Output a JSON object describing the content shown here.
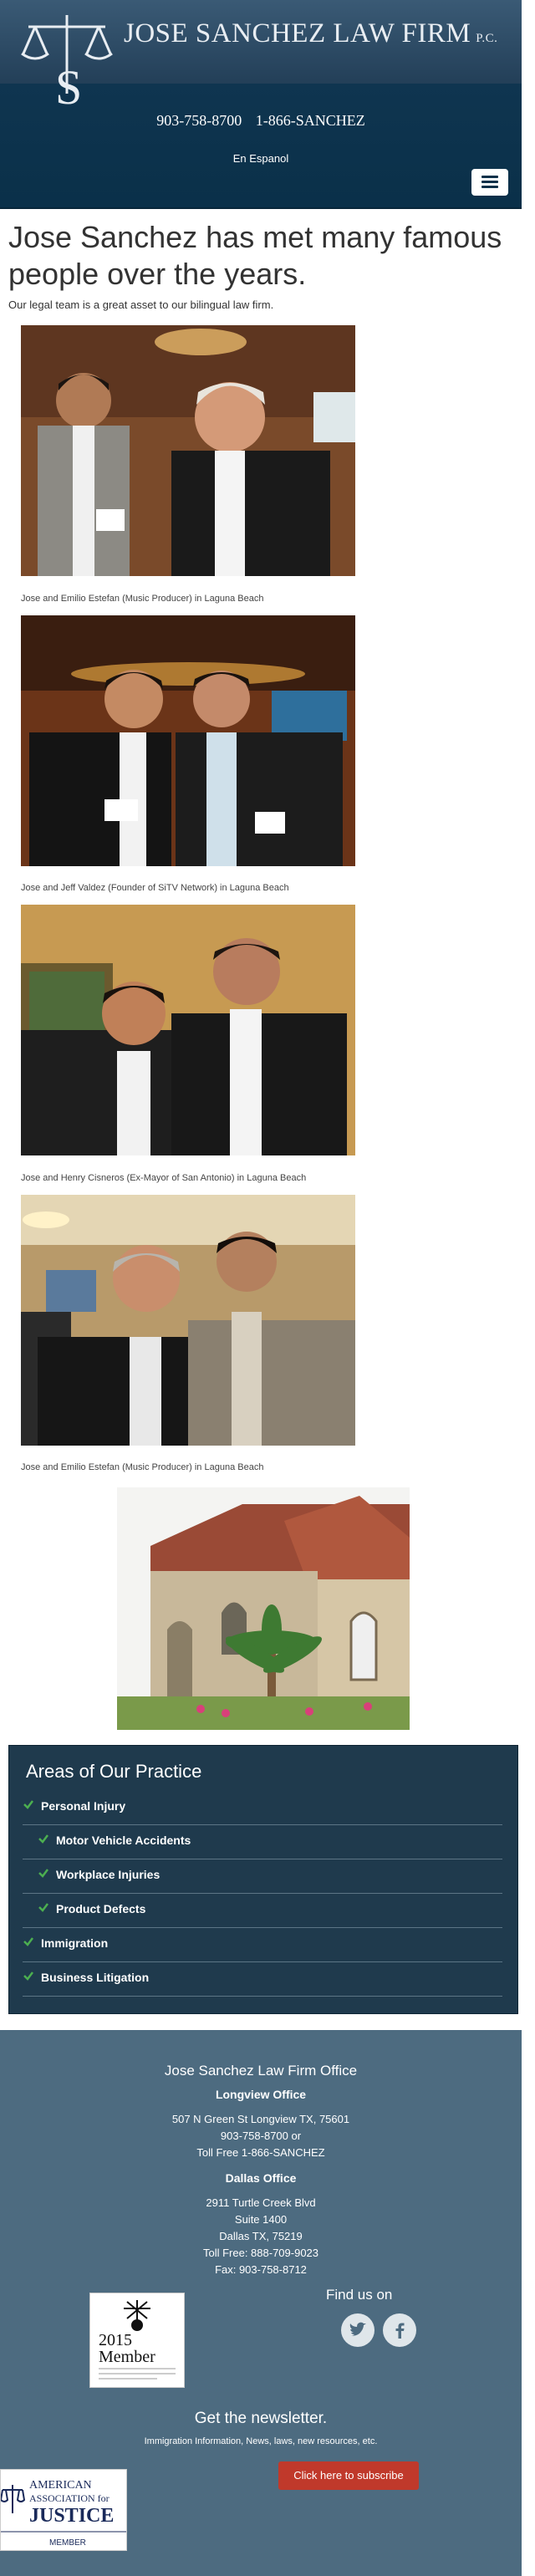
{
  "header": {
    "firm_name": "JOSE SANCHEZ LAW FIRM",
    "firm_suffix": "P.C.",
    "phone_local": "903-758-8700",
    "phone_toll": "1-866-SANCHEZ",
    "language_link": "En Espanol",
    "menu_icon": "hamburger-icon"
  },
  "main": {
    "heading": "Jose Sanchez has met many famous people over the years.",
    "intro": "Our legal team is a great asset to our bilingual law firm.",
    "photos": [
      {
        "caption": "Jose and Emilio Estefan (Music Producer) in Laguna Beach"
      },
      {
        "caption": "Jose and Jeff Valdez (Founder of SiTV Network) in Laguna Beach"
      },
      {
        "caption": "Jose and Henry Cisneros (Ex-Mayor of San Antonio) in Laguna Beach"
      },
      {
        "caption": "Jose and Emilio Estefan (Music Producer) in Laguna Beach"
      }
    ]
  },
  "practice": {
    "title": "Areas of Our Practice",
    "items": [
      {
        "label": "Personal Injury"
      },
      {
        "label": "Motor Vehicle Accidents"
      },
      {
        "label": "Workplace Injuries"
      },
      {
        "label": "Product Defects"
      },
      {
        "label": "Immigration"
      },
      {
        "label": "Business Litigation"
      }
    ]
  },
  "footer": {
    "office_title": "Jose Sanchez Law Firm Office",
    "longview": {
      "title": "Longview Office",
      "address": "507 N Green St Longview TX, 75601",
      "phone": "903-758-8700 or",
      "toll": "Toll Free 1-866-SANCHEZ"
    },
    "dallas": {
      "title": "Dallas Office",
      "street": "2911 Turtle Creek Blvd",
      "suite": "Suite 1400",
      "city": "Dallas TX, 75219",
      "toll": "Toll Free: 888-709-9023",
      "fax": "Fax: 903-758-8712"
    },
    "find_us": "Find us on",
    "award_year": "2015",
    "award_word": "Member",
    "newsletter_title": "Get the newsletter.",
    "newsletter_sub": "Immigration Information, News, laws, new resources, etc.",
    "subscribe_label": "Click here to subscribe",
    "aaj_line1": "AMERICAN",
    "aaj_line2": "ASSOCIATION for",
    "aaj_line3": "JUSTICE",
    "aaj_line4": "MEMBER"
  },
  "colors": {
    "header_bg": "#0a3049",
    "practice_bg": "#1f3a4d",
    "footer_bg": "#4d6b80",
    "check_green": "#4caf50",
    "subscribe_red": "#c0392b"
  }
}
